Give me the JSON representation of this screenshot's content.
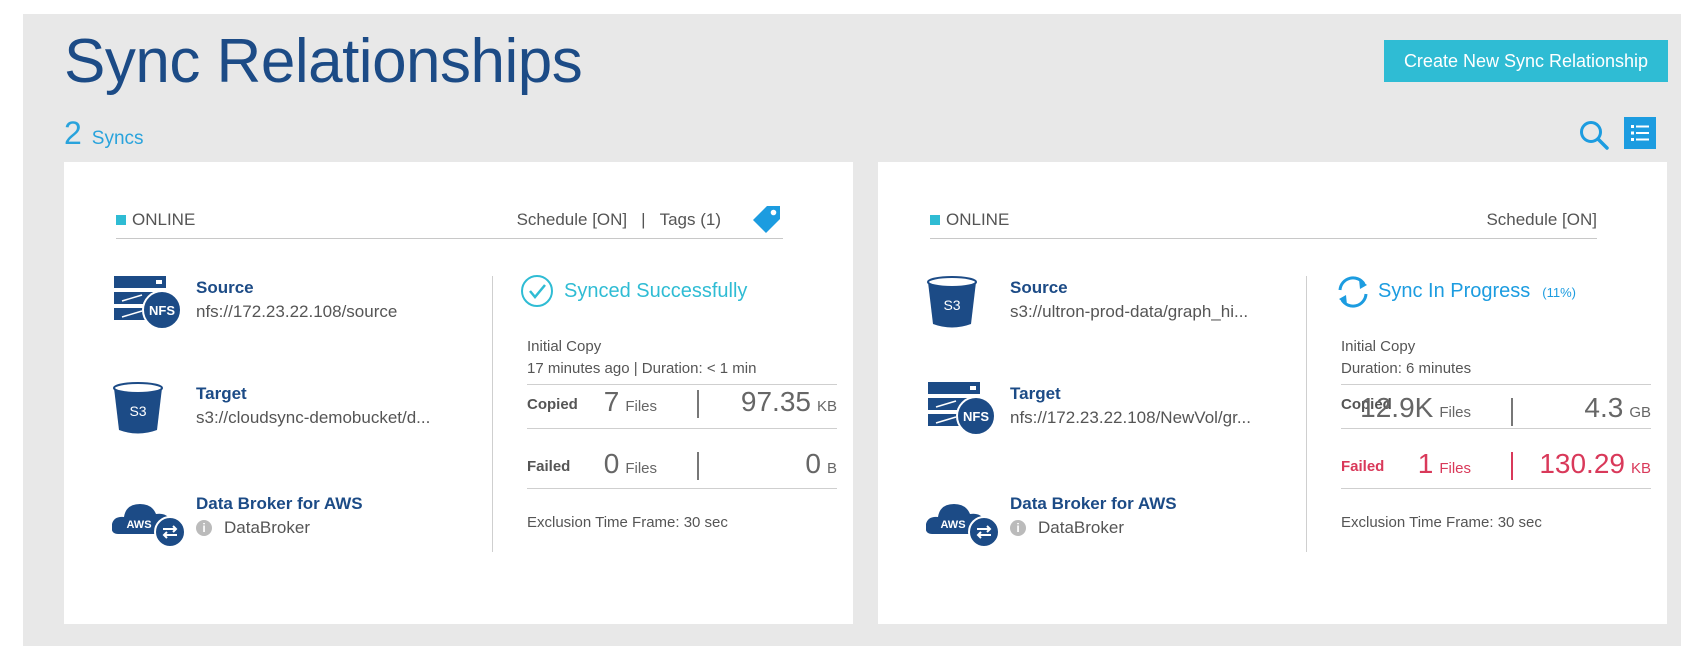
{
  "page": {
    "title": "Sync Relationships",
    "create_button": "Create New Sync Relationship",
    "sync_count": "2",
    "sync_count_label": "Syncs"
  },
  "colors": {
    "accent": "#2fbcd4",
    "brand": "#1c4b86",
    "link": "#1c9ce0",
    "error": "#d9395a"
  },
  "cards": [
    {
      "status": "ONLINE",
      "schedule": "Schedule [ON]",
      "tags": "Tags (1)",
      "source_label": "Source",
      "source_path": "nfs://172.23.22.108/source",
      "source_icon": "NFS",
      "target_label": "Target",
      "target_path": "s3://cloudsync-demobucket/d...",
      "target_icon": "S3",
      "broker_label": "Data Broker for AWS",
      "broker_name": "DataBroker",
      "sync_status": "Synced Successfully",
      "initial_copy": "Initial Copy",
      "initial_detail": "17 minutes ago | Duration: < 1 min",
      "copied_label": "Copied",
      "copied_files": "7",
      "files_unit": "Files",
      "copied_size": "97.35",
      "copied_unit": "KB",
      "failed_label": "Failed",
      "failed_files": "0",
      "failed_size": "0",
      "failed_unit": "B",
      "exclusion": "Exclusion Time Frame: 30 sec"
    },
    {
      "status": "ONLINE",
      "schedule": "Schedule [ON]",
      "source_label": "Source",
      "source_path": "s3://ultron-prod-data/graph_hi...",
      "source_icon": "S3",
      "target_label": "Target",
      "target_path": "nfs://172.23.22.108/NewVol/gr...",
      "target_icon": "NFS",
      "broker_label": "Data Broker for AWS",
      "broker_name": "DataBroker",
      "sync_status": "Sync In Progress",
      "progress": "(11%)",
      "initial_copy": "Initial Copy",
      "initial_detail": "Duration: 6 minutes",
      "copied_label": "Copied",
      "copied_files": "12.9K",
      "files_unit": "Files",
      "copied_size": "4.3",
      "copied_unit": "GB",
      "failed_label": "Failed",
      "failed_files": "1",
      "failed_size": "130.29",
      "failed_unit": "KB",
      "exclusion": "Exclusion Time Frame: 30 sec"
    }
  ]
}
